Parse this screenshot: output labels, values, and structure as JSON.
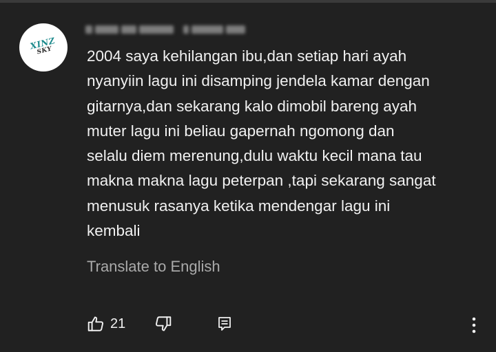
{
  "comment": {
    "avatar_text_line1": "XINZ",
    "avatar_text_line2": "SKY",
    "text": "2004 saya kehilangan ibu,dan setiap hari ayah\nnyanyiin lagu ini disamping jendela kamar dengan\ngitarnya,dan sekarang kalo dimobil bareng ayah\nmuter lagu ini beliau gapernah ngomong dan\nselalu diem merenung,dulu waktu kecil mana tau\nmakna makna lagu peterpan ,tapi sekarang sangat\nmenusuk rasanya ketika mendengar lagu ini\nkembali",
    "translate_label": "Translate to English",
    "like_count": "21"
  },
  "icons": {
    "like": "thumbs-up-icon",
    "dislike": "thumbs-down-icon",
    "reply": "reply-comment-icon",
    "more": "more-vertical-icon"
  },
  "colors": {
    "background": "#212121",
    "text": "#f1f1f1",
    "secondary_text": "#aaaaaa",
    "avatar_accent": "#1c8a8c"
  }
}
